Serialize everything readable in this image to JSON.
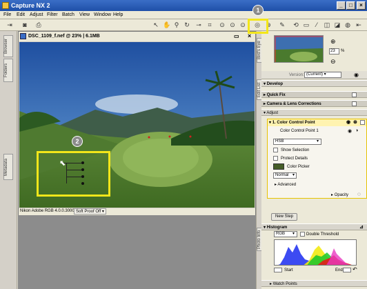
{
  "window": {
    "title": "Capture NX 2",
    "min": "_",
    "max": "□",
    "close": "×"
  },
  "menu": [
    "File",
    "Edit",
    "Adjust",
    "Filter",
    "Batch",
    "View",
    "Window",
    "Help"
  ],
  "left_tabs": {
    "browser": "Browser",
    "folders": "Folders",
    "metadata": "Metadata"
  },
  "document": {
    "title": "DSC_1109_f.nef @ 23% | 6.1MB",
    "color_profile": "Nikon Adobe RGB 4.0.0.3000",
    "soft_proof": "Soft Proof Off"
  },
  "right_tabs": {
    "birds_eye": "Bird's Eye",
    "edit_list": "Edit List",
    "photo_info": "Photo Info"
  },
  "birds_eye": {
    "zoom": "23",
    "unit": "%"
  },
  "edit_list": {
    "version_label": "Version:",
    "version_value": "(Current)",
    "develop": "Develop",
    "quick_fix": "Quick Fix",
    "camera_lens": "Camera & Lens Corrections",
    "adjust": "Adjust",
    "step_title": "1. Color Control Point",
    "point_name": "Color Control Point 1",
    "mode": "HSB",
    "show_selection": "Show Selection",
    "protect_details": "Protect Details",
    "color_picker": "Color Picker",
    "blend": "Normal",
    "advanced": "Advanced",
    "opacity": "Opacity",
    "new_step": "New Step"
  },
  "histogram": {
    "title": "Histogram",
    "channel": "RGB",
    "double_threshold": "Double Threshold",
    "start": "Start",
    "end": "End"
  },
  "watch_points": "Watch Points",
  "callouts": [
    "1",
    "2"
  ],
  "colors": {
    "highlight": "#f3e61a",
    "titlebar": "#1f4fa8",
    "callout": "#8b8b8b"
  }
}
